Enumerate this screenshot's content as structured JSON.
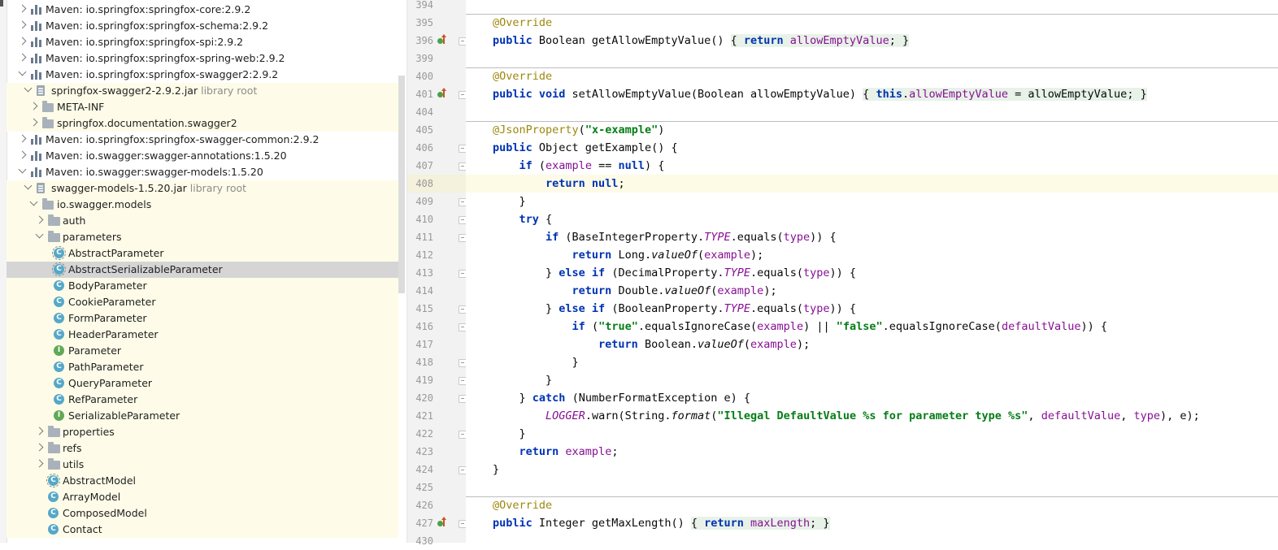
{
  "project_tree": [
    {
      "label": "Maven: io.springfox:springfox-core:2.9.2",
      "type": "maven",
      "arrow": "right",
      "level": 0
    },
    {
      "label": "Maven: io.springfox:springfox-schema:2.9.2",
      "type": "maven",
      "arrow": "right",
      "level": 0
    },
    {
      "label": "Maven: io.springfox:springfox-spi:2.9.2",
      "type": "maven",
      "arrow": "right",
      "level": 0
    },
    {
      "label": "Maven: io.springfox:springfox-spring-web:2.9.2",
      "type": "maven",
      "arrow": "right",
      "level": 0
    },
    {
      "label": "Maven: io.springfox:springfox-swagger2:2.9.2",
      "type": "maven",
      "arrow": "down",
      "level": 0
    },
    {
      "label": "springfox-swagger2-2.9.2.jar",
      "suffix": "library root",
      "type": "jar",
      "arrow": "down",
      "level": 1,
      "highlight": true
    },
    {
      "label": "META-INF",
      "type": "pkg",
      "arrow": "right",
      "level": 2,
      "highlight": true
    },
    {
      "label": "springfox.documentation.swagger2",
      "type": "pkg",
      "arrow": "right",
      "level": 2,
      "highlight": true
    },
    {
      "label": "Maven: io.springfox:springfox-swagger-common:2.9.2",
      "type": "maven",
      "arrow": "right",
      "level": 0
    },
    {
      "label": "Maven: io.swagger:swagger-annotations:1.5.20",
      "type": "maven",
      "arrow": "right",
      "level": 0
    },
    {
      "label": "Maven: io.swagger:swagger-models:1.5.20",
      "type": "maven",
      "arrow": "down",
      "level": 0
    },
    {
      "label": "swagger-models-1.5.20.jar",
      "suffix": "library root",
      "type": "jar",
      "arrow": "down",
      "level": 1,
      "highlight": true
    },
    {
      "label": "io.swagger.models",
      "type": "pkg",
      "arrow": "down",
      "level": 2,
      "highlight": true
    },
    {
      "label": "auth",
      "type": "folder",
      "arrow": "right",
      "level": 3,
      "highlight": true
    },
    {
      "label": "parameters",
      "type": "folder",
      "arrow": "down",
      "level": 3,
      "highlight": true
    },
    {
      "label": "AbstractParameter",
      "type": "class-abs",
      "level": 4,
      "highlight": true
    },
    {
      "label": "AbstractSerializableParameter",
      "type": "class-abs",
      "level": 4,
      "selected": true
    },
    {
      "label": "BodyParameter",
      "type": "class",
      "level": 4,
      "highlight": true
    },
    {
      "label": "CookieParameter",
      "type": "class",
      "level": 4,
      "highlight": true
    },
    {
      "label": "FormParameter",
      "type": "class",
      "level": 4,
      "highlight": true
    },
    {
      "label": "HeaderParameter",
      "type": "class",
      "level": 4,
      "highlight": true
    },
    {
      "label": "Parameter",
      "type": "iface",
      "level": 4,
      "highlight": true
    },
    {
      "label": "PathParameter",
      "type": "class",
      "level": 4,
      "highlight": true
    },
    {
      "label": "QueryParameter",
      "type": "class",
      "level": 4,
      "highlight": true
    },
    {
      "label": "RefParameter",
      "type": "class",
      "level": 4,
      "highlight": true
    },
    {
      "label": "SerializableParameter",
      "type": "iface",
      "level": 4,
      "highlight": true
    },
    {
      "label": "properties",
      "type": "folder",
      "arrow": "right",
      "level": 3,
      "highlight": true
    },
    {
      "label": "refs",
      "type": "folder",
      "arrow": "right",
      "level": 3,
      "highlight": true
    },
    {
      "label": "utils",
      "type": "folder",
      "arrow": "right",
      "level": 3,
      "highlight": true
    },
    {
      "label": "AbstractModel",
      "type": "class-abs",
      "level": 3,
      "highlight": true
    },
    {
      "label": "ArrayModel",
      "type": "class",
      "level": 3,
      "highlight": true
    },
    {
      "label": "ComposedModel",
      "type": "class",
      "level": 3,
      "highlight": true
    },
    {
      "label": "Contact",
      "type": "class",
      "level": 3,
      "highlight": true
    }
  ],
  "editor": {
    "lines": [
      {
        "num": "394",
        "code": []
      },
      {
        "num": "395",
        "sepBefore": true,
        "code": [
          {
            "t": "@Override",
            "c": "an"
          }
        ]
      },
      {
        "num": "396",
        "marker": true,
        "fold": true,
        "code": [
          {
            "t": "public ",
            "c": "kw"
          },
          {
            "t": "Boolean getAllowEmptyValue() "
          },
          {
            "t": "{ ",
            "c": "bx"
          },
          {
            "t": "return ",
            "c": "kw bx"
          },
          {
            "t": "allowEmptyValue",
            "c": "fd bx"
          },
          {
            "t": "; }",
            "c": "bx"
          }
        ]
      },
      {
        "num": "399",
        "code": []
      },
      {
        "num": "400",
        "sepBefore": true,
        "code": [
          {
            "t": "@Override",
            "c": "an"
          }
        ]
      },
      {
        "num": "401",
        "marker": true,
        "fold": true,
        "code": [
          {
            "t": "public void ",
            "c": "kw"
          },
          {
            "t": "setAllowEmptyValue(Boolean allowEmptyValue) "
          },
          {
            "t": "{ ",
            "c": "bx"
          },
          {
            "t": "this",
            "c": "kw bx"
          },
          {
            "t": ".",
            "c": "bx"
          },
          {
            "t": "allowEmptyValue",
            "c": "fd bx"
          },
          {
            "t": " = allowEmptyValue; }",
            "c": "bx"
          }
        ]
      },
      {
        "num": "404",
        "code": []
      },
      {
        "num": "405",
        "sepBefore": true,
        "code": [
          {
            "t": "@JsonProperty",
            "c": "an"
          },
          {
            "t": "("
          },
          {
            "t": "\"x-example\"",
            "c": "st"
          },
          {
            "t": ")"
          }
        ]
      },
      {
        "num": "406",
        "fold": true,
        "code": [
          {
            "t": "public ",
            "c": "kw"
          },
          {
            "t": "Object getExample() {"
          }
        ]
      },
      {
        "num": "407",
        "fold": true,
        "code": [
          {
            "t": "    "
          },
          {
            "t": "if ",
            "c": "kw"
          },
          {
            "t": "("
          },
          {
            "t": "example",
            "c": "fd"
          },
          {
            "t": " == "
          },
          {
            "t": "null",
            "c": "kw"
          },
          {
            "t": ") {"
          }
        ]
      },
      {
        "num": "408",
        "caret": true,
        "code": [
          {
            "t": "        "
          },
          {
            "t": "return null",
            "c": "kw"
          },
          {
            "t": ";"
          }
        ]
      },
      {
        "num": "409",
        "fold": true,
        "code": [
          {
            "t": "    }"
          }
        ]
      },
      {
        "num": "410",
        "fold": true,
        "code": [
          {
            "t": "    "
          },
          {
            "t": "try ",
            "c": "kw"
          },
          {
            "t": "{"
          }
        ]
      },
      {
        "num": "411",
        "fold": true,
        "code": [
          {
            "t": "        "
          },
          {
            "t": "if ",
            "c": "kw"
          },
          {
            "t": "(BaseIntegerProperty."
          },
          {
            "t": "TYPE",
            "c": "cst"
          },
          {
            "t": ".equals("
          },
          {
            "t": "type",
            "c": "fd"
          },
          {
            "t": ")) {"
          }
        ]
      },
      {
        "num": "412",
        "code": [
          {
            "t": "            "
          },
          {
            "t": "return ",
            "c": "kw"
          },
          {
            "t": "Long."
          },
          {
            "t": "valueOf",
            "c": "it"
          },
          {
            "t": "("
          },
          {
            "t": "example",
            "c": "fd"
          },
          {
            "t": ");"
          }
        ]
      },
      {
        "num": "413",
        "fold": true,
        "code": [
          {
            "t": "        } "
          },
          {
            "t": "else if ",
            "c": "kw"
          },
          {
            "t": "(DecimalProperty."
          },
          {
            "t": "TYPE",
            "c": "cst"
          },
          {
            "t": ".equals("
          },
          {
            "t": "type",
            "c": "fd"
          },
          {
            "t": ")) {"
          }
        ]
      },
      {
        "num": "414",
        "code": [
          {
            "t": "            "
          },
          {
            "t": "return ",
            "c": "kw"
          },
          {
            "t": "Double."
          },
          {
            "t": "valueOf",
            "c": "it"
          },
          {
            "t": "("
          },
          {
            "t": "example",
            "c": "fd"
          },
          {
            "t": ");"
          }
        ]
      },
      {
        "num": "415",
        "fold": true,
        "code": [
          {
            "t": "        } "
          },
          {
            "t": "else if ",
            "c": "kw"
          },
          {
            "t": "(BooleanProperty."
          },
          {
            "t": "TYPE",
            "c": "cst"
          },
          {
            "t": ".equals("
          },
          {
            "t": "type",
            "c": "fd"
          },
          {
            "t": ")) {"
          }
        ]
      },
      {
        "num": "416",
        "fold": true,
        "code": [
          {
            "t": "            "
          },
          {
            "t": "if ",
            "c": "kw"
          },
          {
            "t": "("
          },
          {
            "t": "\"true\"",
            "c": "st"
          },
          {
            "t": ".equalsIgnoreCase("
          },
          {
            "t": "example",
            "c": "fd"
          },
          {
            "t": ") || "
          },
          {
            "t": "\"false\"",
            "c": "st"
          },
          {
            "t": ".equalsIgnoreCase("
          },
          {
            "t": "defaultValue",
            "c": "fd"
          },
          {
            "t": ")) {"
          }
        ]
      },
      {
        "num": "417",
        "code": [
          {
            "t": "                "
          },
          {
            "t": "return ",
            "c": "kw"
          },
          {
            "t": "Boolean."
          },
          {
            "t": "valueOf",
            "c": "it"
          },
          {
            "t": "("
          },
          {
            "t": "example",
            "c": "fd"
          },
          {
            "t": ");"
          }
        ]
      },
      {
        "num": "418",
        "fold": true,
        "code": [
          {
            "t": "            }"
          }
        ]
      },
      {
        "num": "419",
        "fold": true,
        "code": [
          {
            "t": "        }"
          }
        ]
      },
      {
        "num": "420",
        "fold": true,
        "code": [
          {
            "t": "    } "
          },
          {
            "t": "catch ",
            "c": "kw"
          },
          {
            "t": "(NumberFormatException e) {"
          }
        ]
      },
      {
        "num": "421",
        "code": [
          {
            "t": "        "
          },
          {
            "t": "LOGGER",
            "c": "cst"
          },
          {
            "t": ".warn(String."
          },
          {
            "t": "format",
            "c": "it"
          },
          {
            "t": "("
          },
          {
            "t": "\"Illegal DefaultValue %s for parameter type %s\"",
            "c": "st"
          },
          {
            "t": ", "
          },
          {
            "t": "defaultValue",
            "c": "fd"
          },
          {
            "t": ", "
          },
          {
            "t": "type",
            "c": "fd"
          },
          {
            "t": "), e);"
          }
        ]
      },
      {
        "num": "422",
        "fold": true,
        "code": [
          {
            "t": "    }"
          }
        ]
      },
      {
        "num": "423",
        "code": [
          {
            "t": "    "
          },
          {
            "t": "return ",
            "c": "kw"
          },
          {
            "t": "example",
            "c": "fd"
          },
          {
            "t": ";"
          }
        ]
      },
      {
        "num": "424",
        "fold": true,
        "code": [
          {
            "t": "}"
          }
        ]
      },
      {
        "num": "425",
        "code": []
      },
      {
        "num": "426",
        "sepBefore": true,
        "code": [
          {
            "t": "@Override",
            "c": "an"
          }
        ]
      },
      {
        "num": "427",
        "marker": true,
        "fold": true,
        "code": [
          {
            "t": "public ",
            "c": "kw"
          },
          {
            "t": "Integer getMaxLength() "
          },
          {
            "t": "{ ",
            "c": "bx"
          },
          {
            "t": "return ",
            "c": "kw bx"
          },
          {
            "t": "maxLength",
            "c": "fd bx"
          },
          {
            "t": "; }",
            "c": "bx"
          }
        ]
      },
      {
        "num": "430",
        "code": []
      }
    ]
  },
  "colors": {
    "tree_highlight": "#fefce8",
    "tree_selected": "#d5d5d5",
    "keyword": "#0033b3",
    "annotation": "#9e880d",
    "string": "#067d17",
    "field": "#871094"
  }
}
